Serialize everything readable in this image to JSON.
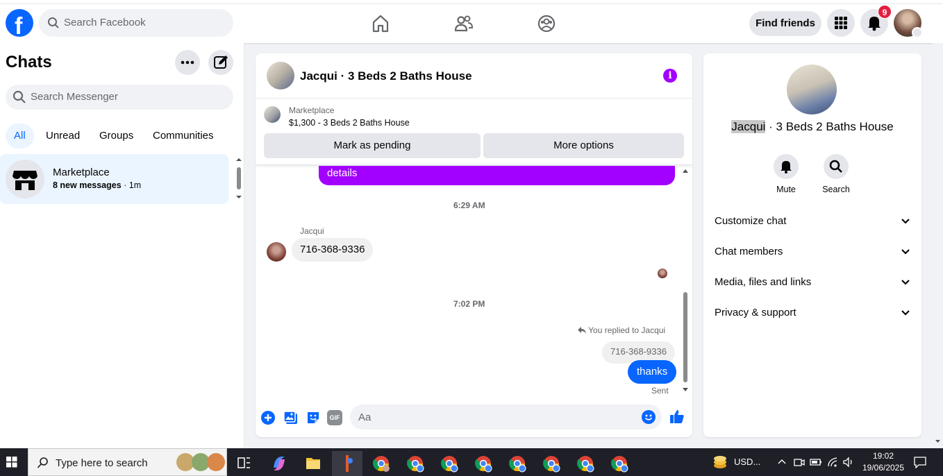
{
  "topbar": {
    "logo_letter": "f",
    "search_placeholder": "Search Facebook",
    "find_friends": "Find friends",
    "notification_count": "9"
  },
  "left": {
    "title": "Chats",
    "search_placeholder": "Search Messenger",
    "filters": [
      "All",
      "Unread",
      "Groups",
      "Communities"
    ],
    "chat": {
      "name": "Marketplace",
      "preview_bold": "8 new messages",
      "preview_time": " · 1m"
    }
  },
  "conversation": {
    "title": "Jacqui · 3 Beds 2 Baths House",
    "marketplace_label": "Marketplace",
    "listing": "$1,300 - 3 Beds 2 Baths House",
    "mark_pending": "Mark as pending",
    "more_options": "More options",
    "top_bubble": "details",
    "time1": "6:29 AM",
    "sender": "Jacqui",
    "incoming": "716-368-9336",
    "time2": "7:02 PM",
    "replied_to": "You replied to Jacqui",
    "quoted": "716-368-9336",
    "outgoing": "thanks",
    "status": "Sent",
    "composer_placeholder": "Aa",
    "gif_label": "GIF"
  },
  "details": {
    "name_highlight": "Jacqui",
    "name_rest": " · 3 Beds 2 Baths House",
    "actions": [
      "Mute",
      "Search"
    ],
    "sections": [
      "Customize chat",
      "Chat members",
      "Media, files and links",
      "Privacy & support"
    ]
  },
  "taskbar": {
    "search_placeholder": "Type here to search",
    "tray_currency": "USD...",
    "time": "19:02",
    "date": "19/06/2025"
  },
  "colors": {
    "brand_blue": "#0866ff",
    "purple_accent": "#a200ff",
    "badge_red": "#e41e3f"
  }
}
